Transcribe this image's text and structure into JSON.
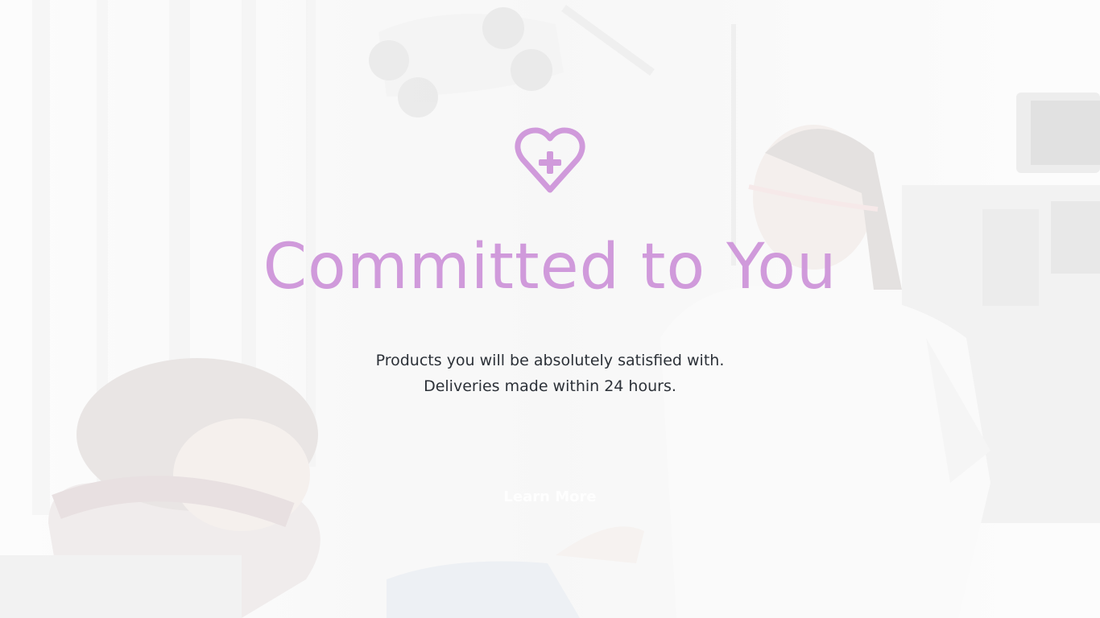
{
  "hero": {
    "icon": "heart-plus-icon",
    "title": "Committed to You",
    "subtitle_line1": "Products you will be absolutely satisfied with.",
    "subtitle_line2": "Deliveries made within 24 hours.",
    "cta_label": "Learn More"
  },
  "colors": {
    "accent": "#d09adb",
    "text": "#2c3138",
    "cta_text": "#ffffff"
  }
}
